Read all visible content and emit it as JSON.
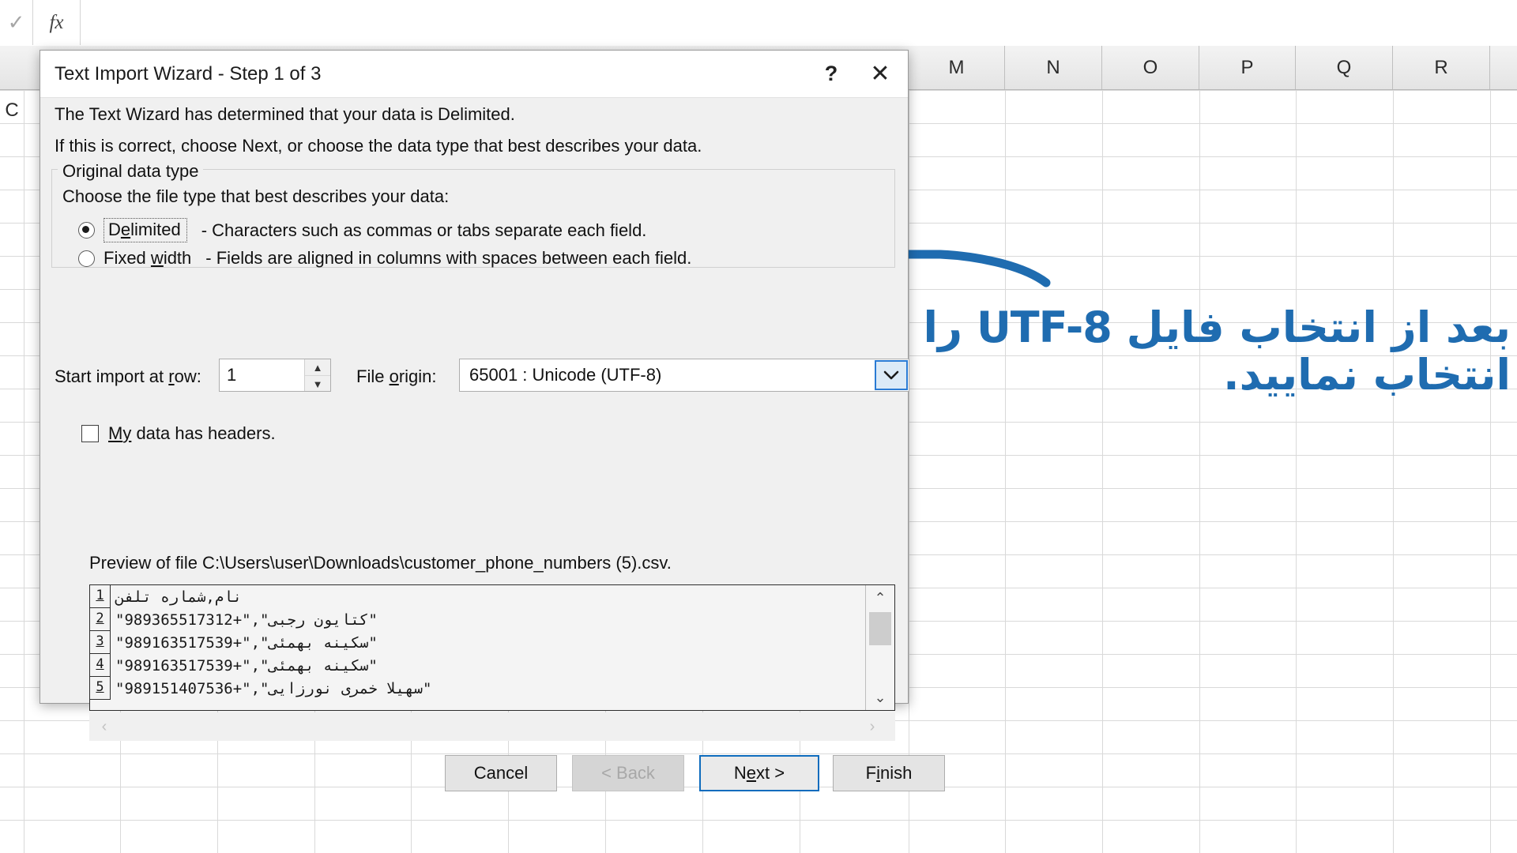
{
  "excel": {
    "formula_bar": {
      "confirm_icon": "check-icon",
      "fx_icon": "fx-icon"
    },
    "row_header_label": "C",
    "column_headers": [
      "M",
      "N",
      "O",
      "P",
      "Q",
      "R"
    ]
  },
  "annotation": {
    "text": "بعد از انتخاب فایل UTF-8 را انتخاب نمایید.",
    "color": "#1F6CB0",
    "arrow": "hand-drawn-arrow-left"
  },
  "dialog": {
    "title": "Text Import Wizard - Step 1 of 3",
    "help_label": "?",
    "close_label": "✕",
    "intro_line1": "The Text Wizard has determined that your data is Delimited.",
    "intro_line2": "If this is correct, choose Next, or choose the data type that best describes your data.",
    "group": {
      "legend": "Original data type",
      "instruction": "Choose the file type that best describes your data:",
      "options": [
        {
          "label_pre": "D",
          "label_accel": "e",
          "label_post": "limited",
          "label": "Delimited",
          "description": "- Characters such as commas or tabs separate each field.",
          "selected": true,
          "focused": true
        },
        {
          "label_pre": "Fixed ",
          "label_accel": "w",
          "label_post": "idth",
          "label": "Fixed width",
          "description": "- Fields are aligned in columns with spaces between each field.",
          "selected": false,
          "focused": false
        }
      ]
    },
    "start_row": {
      "label_pre": "Start import at ",
      "label_accel": "r",
      "label_post": "ow:",
      "label": "Start import at row:",
      "value": "1",
      "spin_up": "▲",
      "spin_down": "▼"
    },
    "file_origin": {
      "label_pre": "File ",
      "label_accel": "o",
      "label_post": "rigin:",
      "label": "File origin:",
      "value": "65001 : Unicode (UTF-8)",
      "dropdown_icon": "chevron-down-icon",
      "dropdown_highlight_color": "#2a7bd4"
    },
    "headers_checkbox": {
      "label_pre": "M",
      "label_accel": "y",
      "label_post": " data has headers.",
      "label": "My data has headers.",
      "checked": false
    },
    "preview": {
      "label": "Preview of file C:\\Users\\user\\Downloads\\customer_phone_numbers (5).csv.",
      "rows": [
        {
          "num": "1",
          "text": "نام,شماره تلفن"
        },
        {
          "num": "2",
          "text": "\"کتایون رجبی\",\"+989365517312\""
        },
        {
          "num": "3",
          "text": "\"سکینه بهمئی\",\"+989163517539\""
        },
        {
          "num": "4",
          "text": "\"سکینه بهمئی\",\"+989163517539\""
        },
        {
          "num": "5",
          "text": "\"سهیلا خمری نورزایی\",\"+989151407536\""
        }
      ],
      "scroll_up_icon": "chevron-up-icon",
      "scroll_down_icon": "chevron-down-icon",
      "scroll_left_icon": "chevron-left-icon",
      "scroll_right_icon": "chevron-right-icon"
    },
    "buttons": {
      "cancel": "Cancel",
      "back": "< Back",
      "back_disabled": true,
      "next_pre": "N",
      "next_accel": "e",
      "next_post": "xt >",
      "next": "Next >",
      "next_is_default": true,
      "finish_pre": "F",
      "finish_accel": "i",
      "finish_post": "nish",
      "finish": "Finish"
    }
  }
}
